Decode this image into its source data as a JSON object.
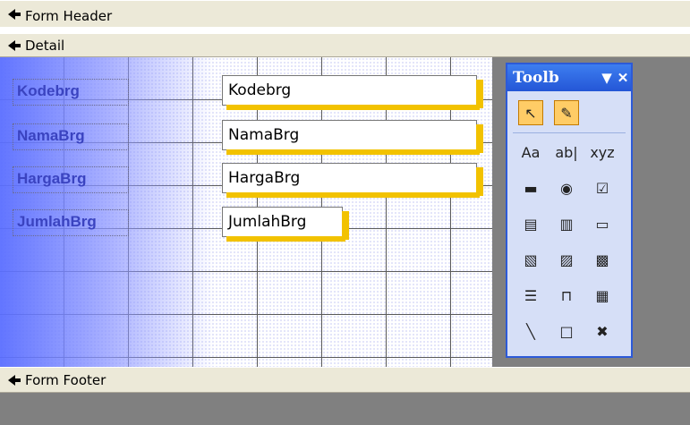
{
  "sections": {
    "form_header": "Form Header",
    "detail": "Detail",
    "form_footer": "Form Footer"
  },
  "labels": [
    {
      "text": "Kodebrg"
    },
    {
      "text": "NamaBrg"
    },
    {
      "text": "HargaBrg"
    },
    {
      "text": "JumlahBrg"
    }
  ],
  "fields": [
    {
      "text": "Kodebrg"
    },
    {
      "text": "NamaBrg"
    },
    {
      "text": "HargaBrg"
    },
    {
      "text": "JumlahBrg"
    }
  ],
  "toolbox": {
    "title": "Toolb",
    "dropdown_glyph": "▼",
    "close_glyph": "✕",
    "tools": [
      {
        "name": "select-objects-tool",
        "glyph": "↖",
        "active": true
      },
      {
        "name": "control-wizards-tool",
        "glyph": "✎",
        "active": true
      },
      {
        "name": "label-tool",
        "glyph": "Aa"
      },
      {
        "name": "text-box-tool",
        "glyph": "ab|"
      },
      {
        "name": "option-group-tool",
        "glyph": "xyz"
      },
      {
        "name": "toggle-button-tool",
        "glyph": "▬"
      },
      {
        "name": "option-button-tool",
        "glyph": "◉"
      },
      {
        "name": "check-box-tool",
        "glyph": "☑"
      },
      {
        "name": "combo-box-tool",
        "glyph": "▤"
      },
      {
        "name": "list-box-tool",
        "glyph": "▥"
      },
      {
        "name": "command-button-tool",
        "glyph": "▭"
      },
      {
        "name": "image-tool",
        "glyph": "▧"
      },
      {
        "name": "unbound-object-frame-tool",
        "glyph": "▨"
      },
      {
        "name": "bound-object-frame-tool",
        "glyph": "▩"
      },
      {
        "name": "page-break-tool",
        "glyph": "☰"
      },
      {
        "name": "tab-control-tool",
        "glyph": "⊓"
      },
      {
        "name": "subform-tool",
        "glyph": "▦"
      },
      {
        "name": "line-tool",
        "glyph": "╲"
      },
      {
        "name": "rectangle-tool",
        "glyph": "□"
      },
      {
        "name": "more-controls-tool",
        "glyph": "✖"
      }
    ]
  }
}
